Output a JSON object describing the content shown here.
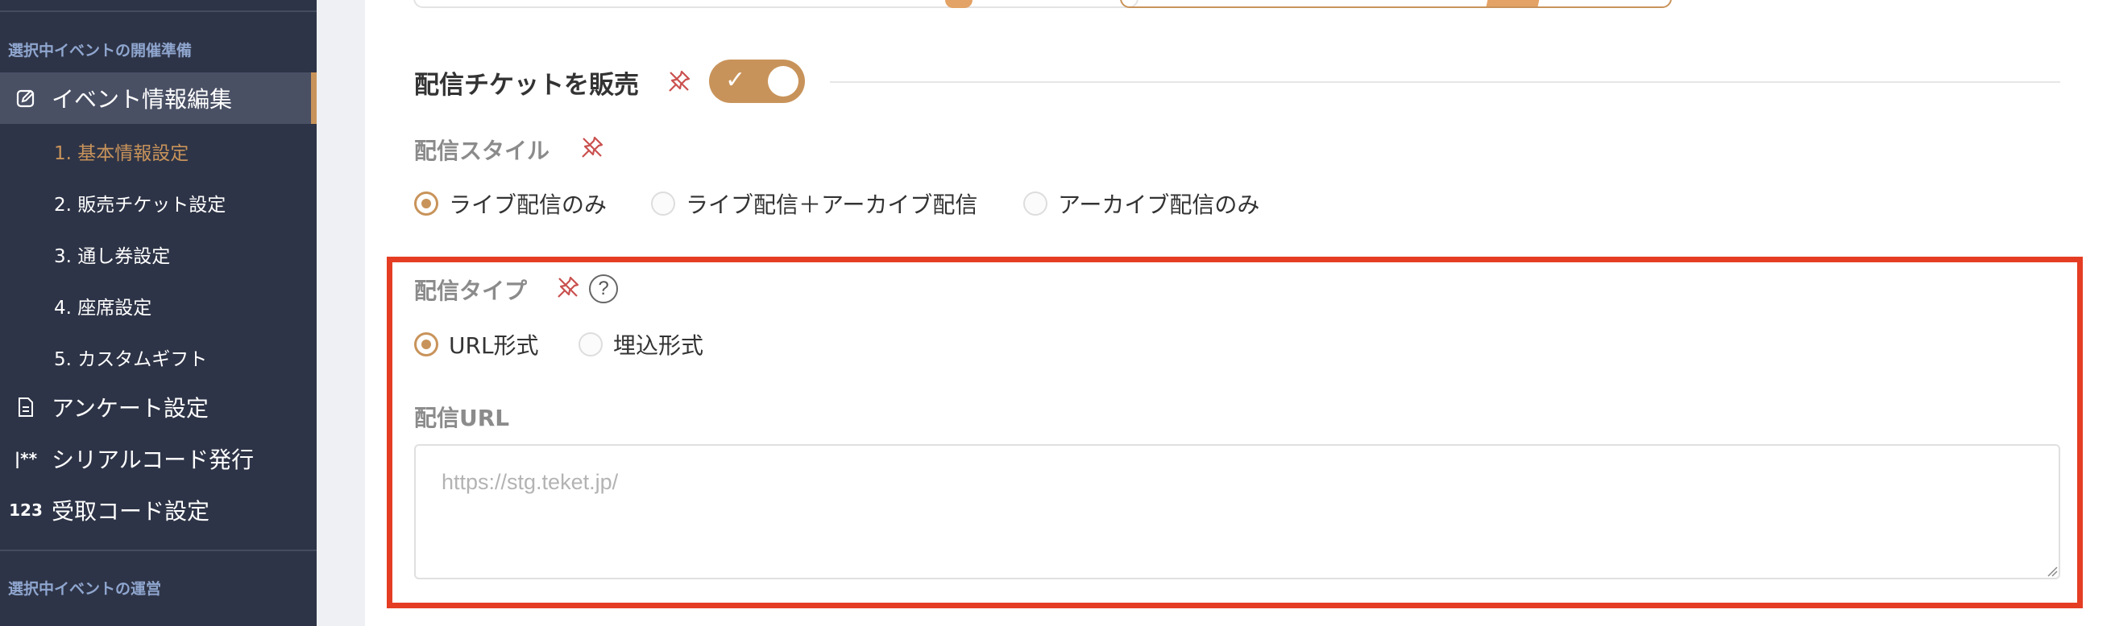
{
  "sidebar": {
    "section_prep": "選択中イベントの開催準備",
    "event_edit": "イベント情報編集",
    "sub_items": [
      "1. 基本情報設定",
      "2. 販売チケット設定",
      "3. 通し券設定",
      "4. 座席設定",
      "5. カスタムギフト"
    ],
    "survey": "アンケート設定",
    "serial_icon": "|**",
    "serial": "シリアルコード発行",
    "receive_icon": "123",
    "receive": "受取コード設定",
    "section_ops": "選択中イベントの運営"
  },
  "main": {
    "section_title": "配信チケットを販売",
    "toggle_on": true,
    "toggle_check": "✓",
    "style_label": "配信スタイル",
    "style_options": [
      "ライブ配信のみ",
      "ライブ配信＋アーカイブ配信",
      "アーカイブ配信のみ"
    ],
    "style_selected": 0,
    "type_label": "配信タイプ",
    "help": "?",
    "type_options": [
      "URL形式",
      "埋込形式"
    ],
    "type_selected": 0,
    "url_label": "配信URL",
    "url_placeholder": "https://stg.teket.jp/",
    "url_value": ""
  },
  "colors": {
    "accent": "#c8935a",
    "highlight": "#e43d24",
    "sidebar_bg": "#2e3447"
  },
  "icons": [
    "edit-icon",
    "document-icon",
    "pin-off-icon",
    "question-icon"
  ]
}
